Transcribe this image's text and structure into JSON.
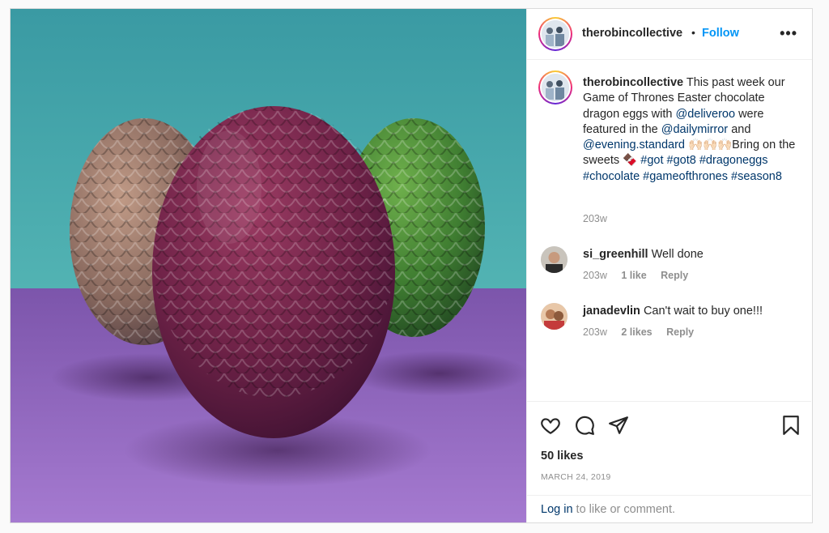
{
  "post": {
    "username": "therobincollective",
    "separator": "•",
    "follow_label": "Follow",
    "more_label": "•••"
  },
  "caption": {
    "username": "therobincollective",
    "text_1": "This past week our Game of Thrones Easter chocolate dragon eggs with",
    "mention_1": "@deliveroo",
    "text_2": "were featured in the",
    "mention_2": "@dailymirror",
    "text_3": "and",
    "mention_3": "@evening.standard",
    "emoji": "🙌🏻🙌🏻🙌🏻",
    "text_4": "Bring on the sweets 🍫",
    "hashtags": [
      "#got",
      "#got8",
      "#dragoneggs",
      "#chocolate",
      "#gameofthrones",
      "#season8"
    ],
    "age": "203w"
  },
  "comments": [
    {
      "username": "si_greenhill",
      "text": "Well done",
      "age": "203w",
      "likes": "1 like",
      "reply": "Reply"
    },
    {
      "username": "janadevlin",
      "text": "Can't wait to buy one!!!",
      "age": "203w",
      "likes": "2 likes",
      "reply": "Reply"
    }
  ],
  "actions": {
    "icons": [
      "heart-icon",
      "comment-icon",
      "share-icon",
      "bookmark-icon"
    ],
    "likes": "50 likes",
    "date": "MARCH 24, 2019"
  },
  "login": {
    "link": "Log in",
    "text": "to like or comment."
  },
  "colors": {
    "link_blue": "#0095f6",
    "mention": "#00376b",
    "muted": "#8e8e8e",
    "bg_teal": "#3f9fa6",
    "floor_purple": "#8f63b8"
  }
}
